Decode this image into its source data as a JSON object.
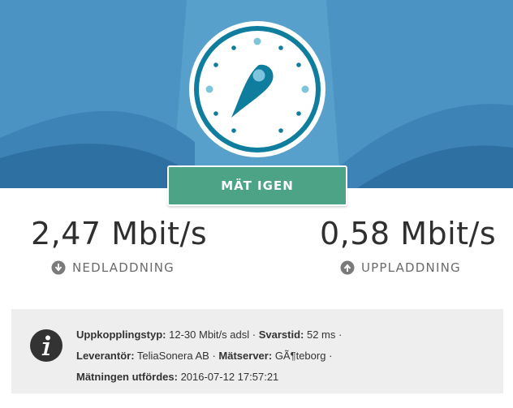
{
  "colors": {
    "hero_bg": "#4b93c2",
    "accent": "#0f7d9e",
    "button": "#4ca386",
    "info_bg": "#eeeeee"
  },
  "gauge": {
    "icon": "speedometer-icon"
  },
  "actions": {
    "retest_label": "MÄT IGEN"
  },
  "results": {
    "download": {
      "value": "2,47 Mbit/s",
      "label": "NEDLADDNING",
      "icon": "download-arrow-icon"
    },
    "upload": {
      "value": "0,58 Mbit/s",
      "label": "UPPLADDNING",
      "icon": "upload-arrow-icon"
    }
  },
  "info": {
    "icon": "info-icon",
    "connection_type_label": "Uppkopplingstyp:",
    "connection_type_value": "12-30 Mbit/s adsl",
    "response_time_label": "Svarstid:",
    "response_time_value": "52 ms",
    "provider_label": "Leverantör:",
    "provider_value": "TeliaSonera AB",
    "server_label": "Mätserver:",
    "server_value": "GÃ¶teborg",
    "performed_label": "Mätningen utfördes:",
    "performed_value": "2016-07-12 17:57:21",
    "separator": "·"
  }
}
